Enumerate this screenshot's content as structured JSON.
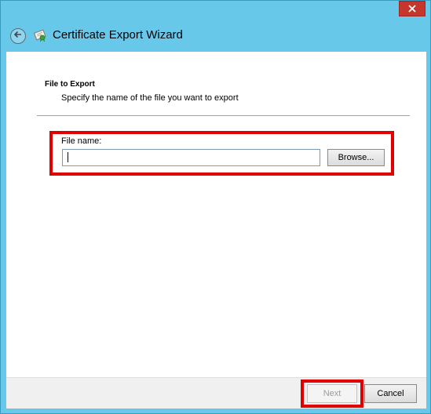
{
  "window": {
    "title": "Certificate Export Wizard",
    "close_icon": "close-icon",
    "back_icon": "back-arrow-icon",
    "app_icon": "certificate-icon"
  },
  "page": {
    "section_title": "File to Export",
    "section_description": "Specify the name of the file you want to export"
  },
  "form": {
    "file_name_label": "File name:",
    "file_name_value": "",
    "browse_label": "Browse..."
  },
  "footer": {
    "next_label": "Next",
    "next_enabled": false,
    "cancel_label": "Cancel"
  },
  "colors": {
    "chrome": "#68c8ea",
    "highlight": "#e00000",
    "close_button": "#c7362c"
  }
}
